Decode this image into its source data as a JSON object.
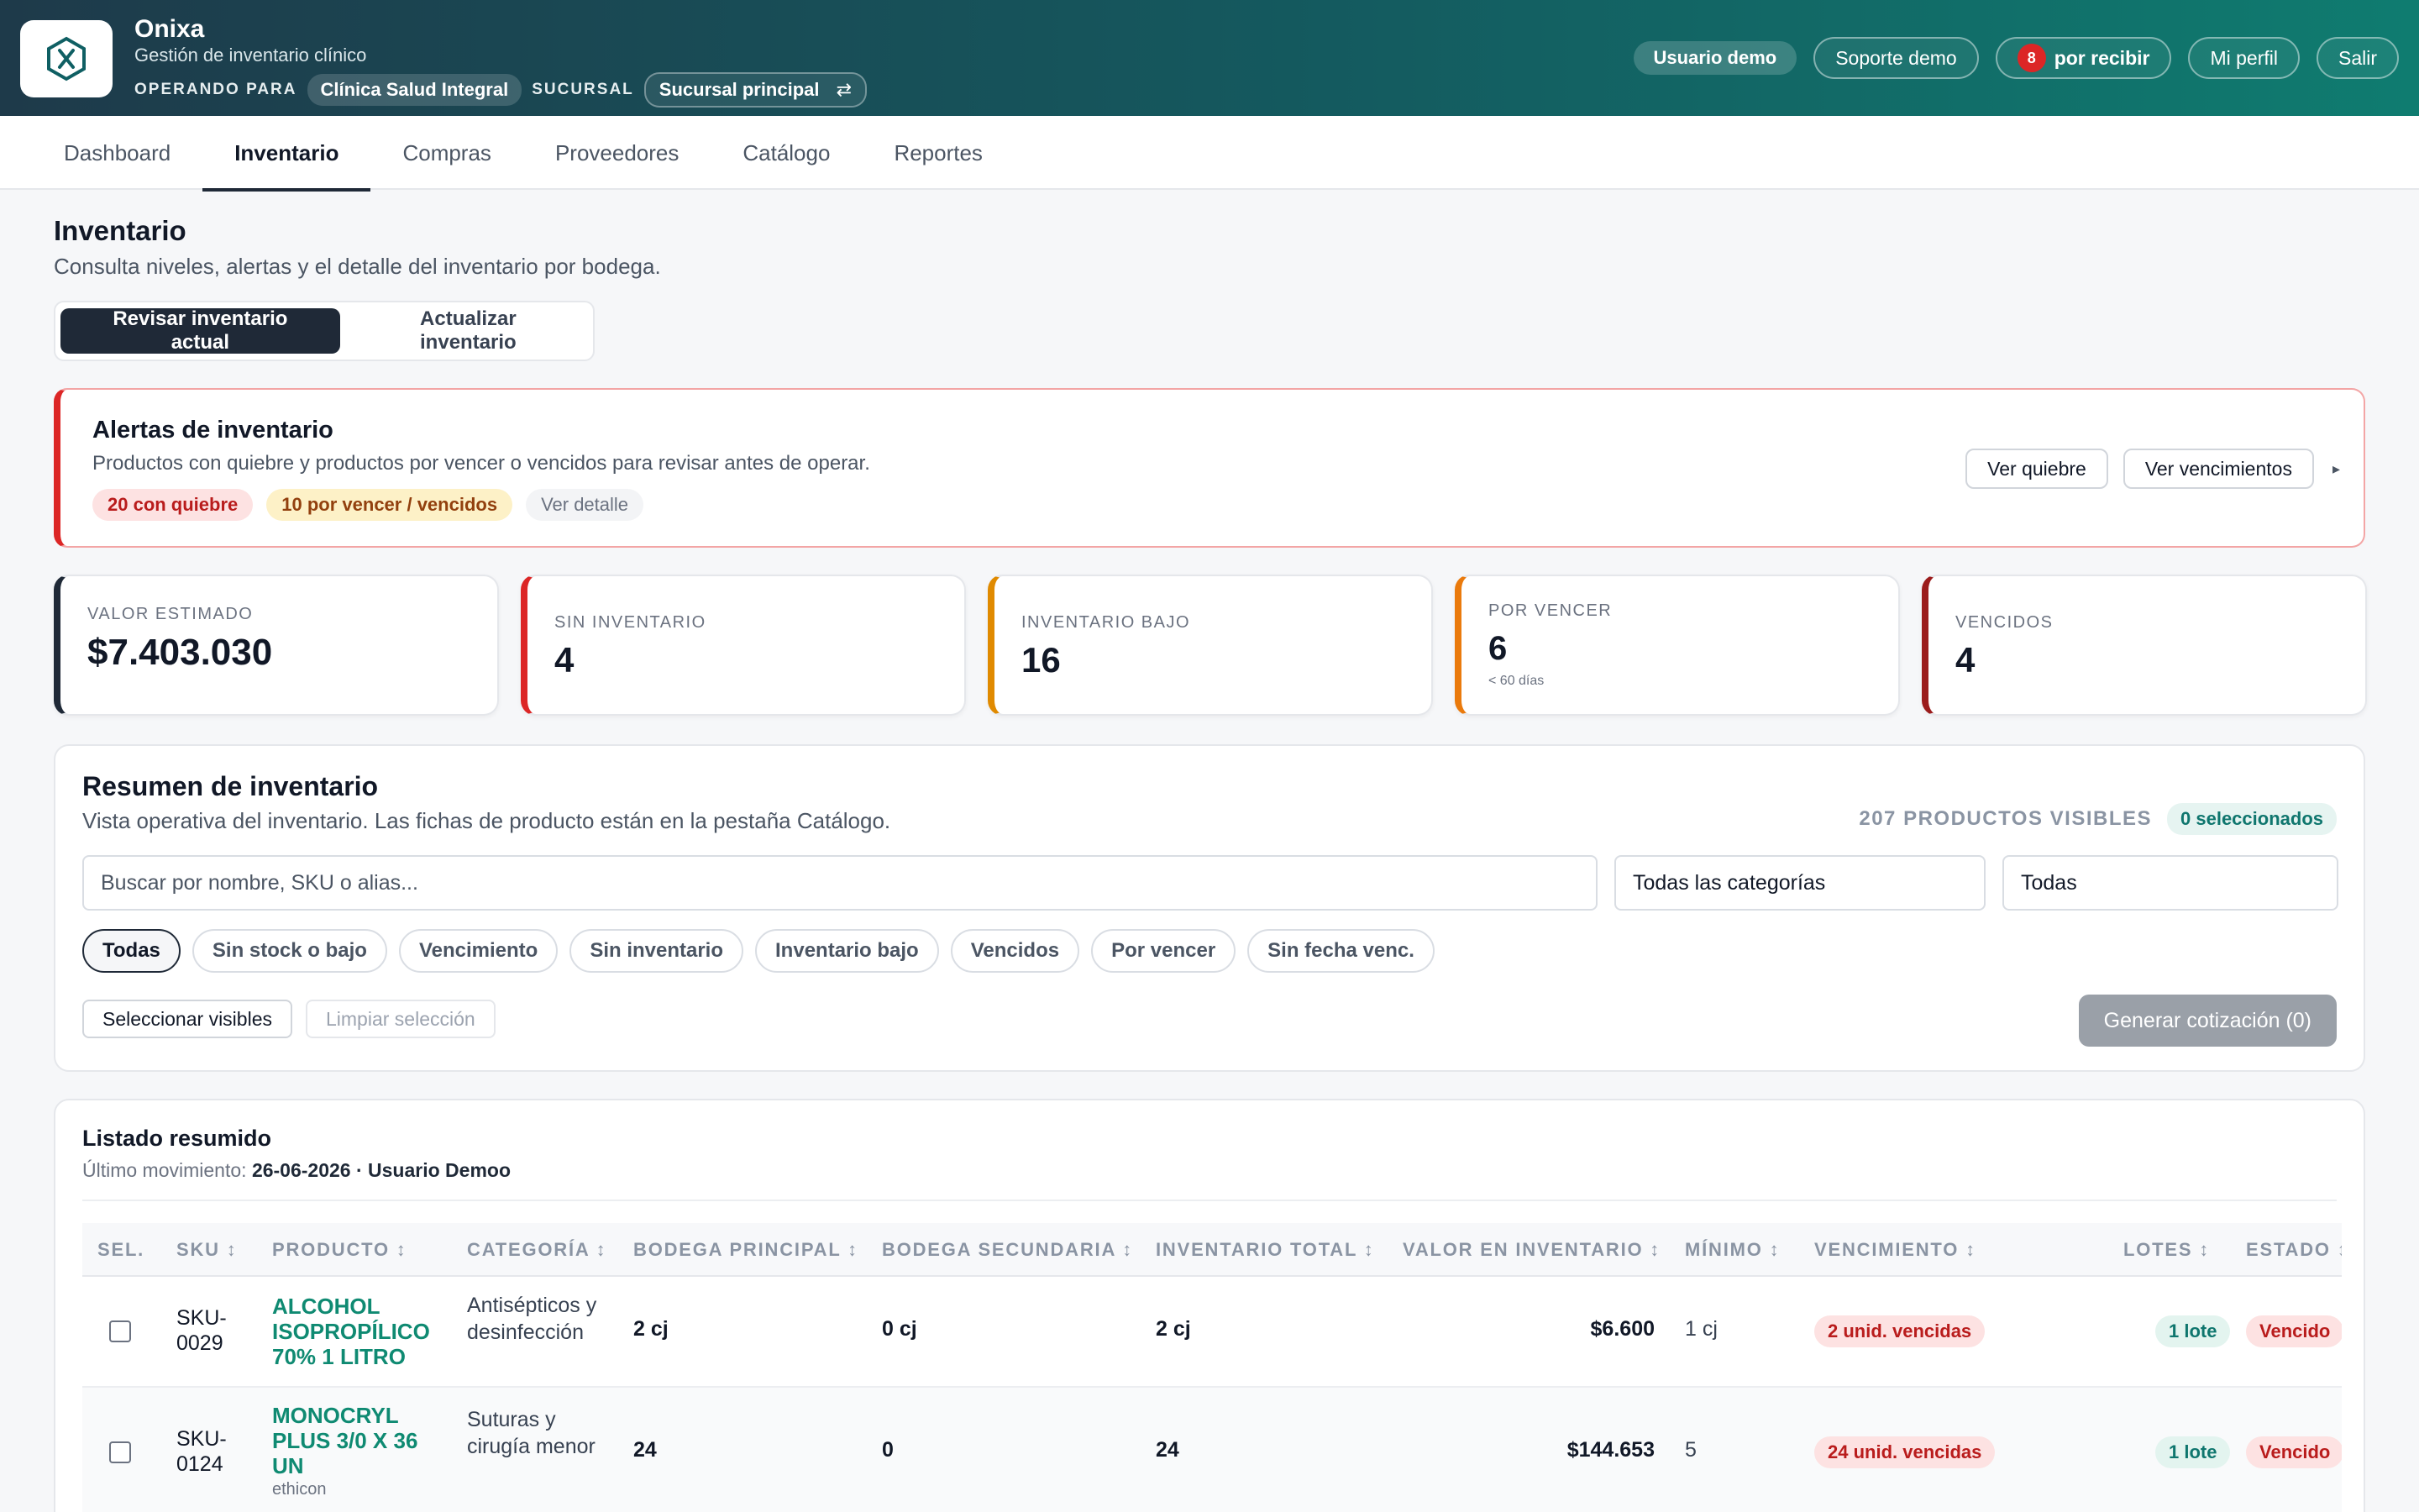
{
  "header": {
    "brand_name": "Onixa",
    "brand_sub": "Gestión de inventario clínico",
    "operating_label": "OPERANDO PARA",
    "clinic": "Clínica Salud Integral",
    "branch_label": "SUCURSAL",
    "branch": "Sucursal principal",
    "swap_glyph": "⇄",
    "user_btn": "Usuario demo",
    "support_btn": "Soporte demo",
    "receive_count": "8",
    "receive_btn": "por recibir",
    "profile_btn": "Mi perfil",
    "logout_btn": "Salir"
  },
  "nav": {
    "tabs": [
      "Dashboard",
      "Inventario",
      "Compras",
      "Proveedores",
      "Catálogo",
      "Reportes"
    ],
    "active": "Inventario"
  },
  "page": {
    "title": "Inventario",
    "subtitle": "Consulta niveles, alertas y el detalle del inventario por bodega.",
    "seg_review": "Revisar inventario actual",
    "seg_update": "Actualizar inventario"
  },
  "alerts": {
    "title": "Alertas de inventario",
    "subtitle": "Productos con quiebre y productos por vencer o vencidos para revisar antes de operar.",
    "chip_break": "20 con quiebre",
    "chip_expiry": "10 por vencer / vencidos",
    "chip_detail": "Ver detalle",
    "btn_break": "Ver quiebre",
    "btn_expiry": "Ver vencimientos",
    "caret": "▸"
  },
  "stats": [
    {
      "label": "VALOR ESTIMADO",
      "value": "$7.403.030",
      "note": "",
      "color": "#1f2937"
    },
    {
      "label": "SIN INVENTARIO",
      "value": "4",
      "note": "",
      "color": "#dc2626"
    },
    {
      "label": "INVENTARIO BAJO",
      "value": "16",
      "note": "",
      "color": "#e08a00"
    },
    {
      "label": "POR VENCER",
      "value": "6",
      "note": "< 60 días",
      "color": "#ea7a0c"
    },
    {
      "label": "VENCIDOS",
      "value": "4",
      "note": "",
      "color": "#9b1c1c"
    }
  ],
  "summary": {
    "title": "Resumen de inventario",
    "subtitle": "Vista operativa del inventario. Las fichas de producto están en la pestaña Catálogo.",
    "visible_count": "207 PRODUCTOS VISIBLES",
    "selected": "0 seleccionados",
    "search_placeholder": "Buscar por nombre, SKU o alias...",
    "category_select": "Todas las categorías",
    "status_select": "Todas",
    "filters": [
      "Todas",
      "Sin stock o bajo",
      "Vencimiento",
      "Sin inventario",
      "Inventario bajo",
      "Vencidos",
      "Por vencer",
      "Sin fecha venc."
    ],
    "active_filter": "Todas",
    "btn_select_visible": "Seleccionar visibles",
    "btn_clear": "Limpiar selección",
    "btn_generate": "Generar cotización (0)"
  },
  "listing": {
    "title": "Listado resumido",
    "last_move_label": "Último movimiento:",
    "last_move_value": "26-06-2026 · Usuario Demoo",
    "columns": [
      "SEL.",
      "SKU ↕",
      "PRODUCTO ↕",
      "CATEGORÍA ↕",
      "BODEGA PRINCIPAL ↕",
      "BODEGA SECUNDARIA ↕",
      "INVENTARIO TOTAL ↕",
      "VALOR EN INVENTARIO ↕",
      "MÍNIMO ↕",
      "VENCIMIENTO ↕",
      "LOTES ↕",
      "ESTADO ↕"
    ],
    "rows": [
      {
        "sku": "SKU-\n0029",
        "product": "ALCOHOL ISOPROPÍLICO 70% 1 LITRO",
        "brand": "",
        "category": "Antisépticos y desinfección",
        "main": "2 cj",
        "secondary": "0 cj",
        "total": "2 cj",
        "value": "$6.600",
        "min": "1 cj",
        "expiry": "2 unid. vencidas",
        "lots": "1 lote",
        "status": "Vencido"
      },
      {
        "sku": "SKU-\n0124",
        "product": "MONOCRYL PLUS 3/0 X 36 UN",
        "brand": "ethicon",
        "category": "Suturas y cirugía menor",
        "main": "24",
        "secondary": "0",
        "total": "24",
        "value": "$144.653",
        "min": "5",
        "expiry": "24 unid. vencidas",
        "lots": "1 lote",
        "status": "Vencido"
      }
    ]
  }
}
